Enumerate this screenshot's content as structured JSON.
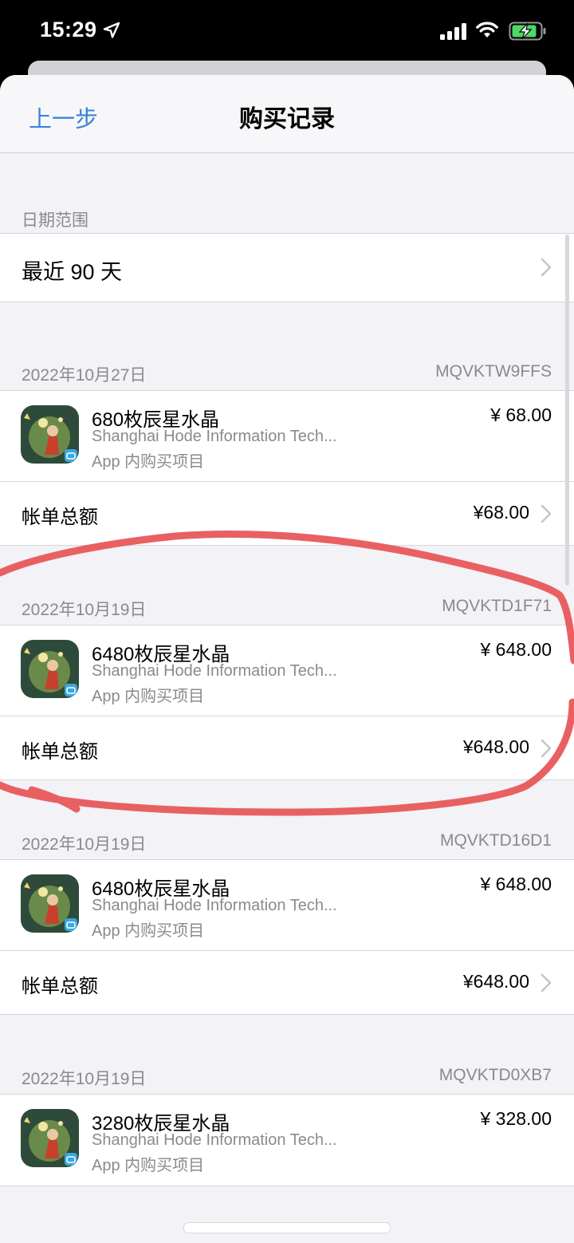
{
  "status_bar": {
    "time": "15:29"
  },
  "nav": {
    "back_label": "上一步",
    "title": "购买记录"
  },
  "date_range": {
    "header": "日期范围",
    "value": "最近 90 天"
  },
  "purchases": [
    {
      "date": "2022年10月27日",
      "order_id": "MQVKTW9FFS",
      "item": {
        "name": "680枚辰星水晶",
        "developer": "Shanghai Hode Information Tech...",
        "type": "App 内购买项目",
        "price": "¥ 68.00"
      },
      "total_label": "帐单总额",
      "total": "¥68.00"
    },
    {
      "date": "2022年10月19日",
      "order_id": "MQVKTD1F71",
      "item": {
        "name": "6480枚辰星水晶",
        "developer": "Shanghai Hode Information Tech...",
        "type": "App 内购买项目",
        "price": "¥ 648.00"
      },
      "total_label": "帐单总额",
      "total": "¥648.00"
    },
    {
      "date": "2022年10月19日",
      "order_id": "MQVKTD16D1",
      "item": {
        "name": "6480枚辰星水晶",
        "developer": "Shanghai Hode Information Tech...",
        "type": "App 内购买项目",
        "price": "¥ 648.00"
      },
      "total_label": "帐单总额",
      "total": "¥648.00"
    },
    {
      "date": "2022年10月19日",
      "order_id": "MQVKTD0XB7",
      "item": {
        "name": "3280枚辰星水晶",
        "developer": "Shanghai Hode Information Tech...",
        "type": "App 内购买项目",
        "price": "¥ 328.00"
      }
    }
  ],
  "colors": {
    "accent": "#3b82d8",
    "annotation": "#e8575a",
    "background": "#f2f2f7"
  }
}
